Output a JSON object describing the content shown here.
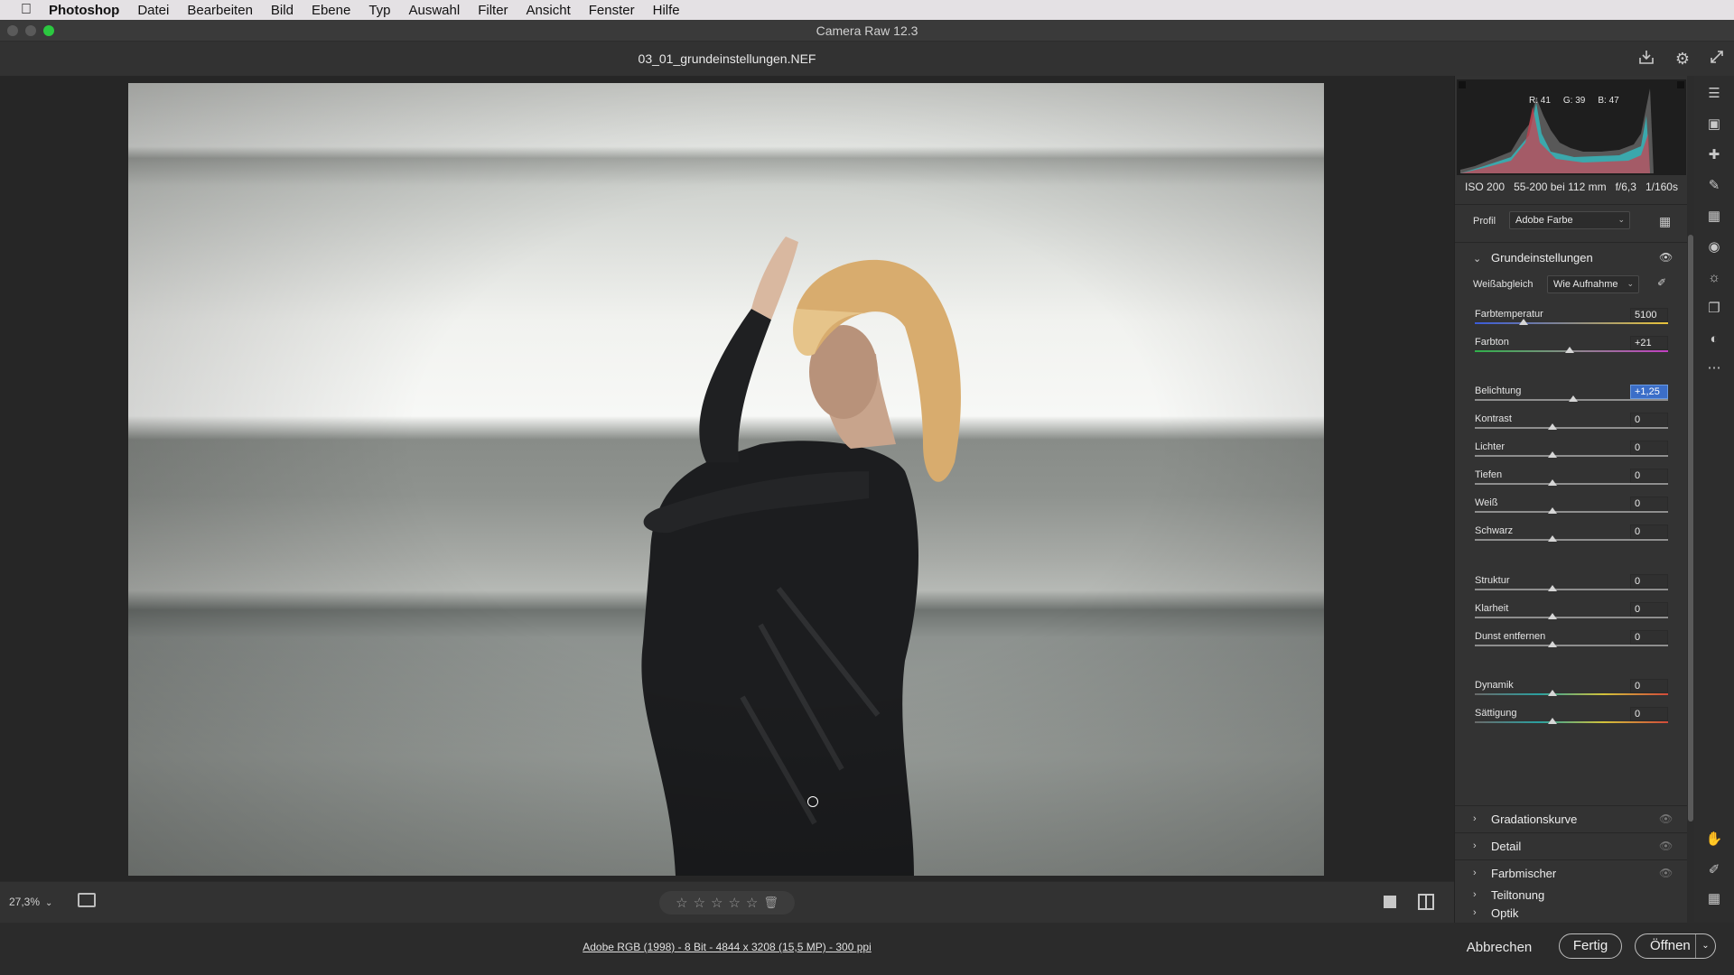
{
  "menubar": {
    "apple": "",
    "items": [
      "Photoshop",
      "Datei",
      "Bearbeiten",
      "Bild",
      "Ebene",
      "Typ",
      "Auswahl",
      "Filter",
      "Ansicht",
      "Fenster",
      "Hilfe"
    ]
  },
  "window": {
    "title": "Camera Raw 12.3"
  },
  "header": {
    "filename": "03_01_grundeinstellungen.NEF",
    "icons": [
      "save-icon",
      "gear-icon",
      "fullscreen-icon"
    ]
  },
  "histogram": {
    "r": "R: 41",
    "g": "G: 39",
    "b": "B: 47"
  },
  "exif": {
    "iso": "ISO 200",
    "lens": "55-200 bei 112 mm",
    "aperture": "f/6,3",
    "shutter": "1/160s"
  },
  "profile": {
    "label": "Profil",
    "value": "Adobe Farbe"
  },
  "basic": {
    "title": "Grundeinstellungen",
    "wb_label": "Weißabgleich",
    "wb_value": "Wie Aufnahme",
    "sliders": [
      {
        "label": "Farbtemperatur",
        "value": "5100",
        "pos": 0.25,
        "active": false
      },
      {
        "label": "Farbton",
        "value": "+21",
        "pos": 0.49,
        "active": false
      },
      {
        "label": "Belichtung",
        "value": "+1,25",
        "pos": 0.51,
        "active": true
      },
      {
        "label": "Kontrast",
        "value": "0",
        "pos": 0.4,
        "active": false
      },
      {
        "label": "Lichter",
        "value": "0",
        "pos": 0.4,
        "active": false
      },
      {
        "label": "Tiefen",
        "value": "0",
        "pos": 0.4,
        "active": false
      },
      {
        "label": "Weiß",
        "value": "0",
        "pos": 0.4,
        "active": false
      },
      {
        "label": "Schwarz",
        "value": "0",
        "pos": 0.4,
        "active": false
      },
      {
        "label": "Struktur",
        "value": "0",
        "pos": 0.4,
        "active": false
      },
      {
        "label": "Klarheit",
        "value": "0",
        "pos": 0.4,
        "active": false
      },
      {
        "label": "Dunst entfernen",
        "value": "0",
        "pos": 0.4,
        "active": false
      },
      {
        "label": "Dynamik",
        "value": "0",
        "pos": 0.4,
        "active": false
      },
      {
        "label": "Sättigung",
        "value": "0",
        "pos": 0.4,
        "active": false
      }
    ]
  },
  "sections": [
    "Gradationskurve",
    "Detail",
    "Farbmischer",
    "Teiltonung",
    "Optik"
  ],
  "toolbar_bottom": {
    "zoom": "27,3%",
    "rating_stars": 0,
    "stars_total": 5
  },
  "footer": {
    "info": "Adobe RGB (1998) - 8 Bit - 4844 x 3208 (15,5 MP) - 300 ppi",
    "cancel": "Abbrechen",
    "done": "Fertig",
    "open": "Öffnen"
  },
  "tools": [
    "edit-icon",
    "crop-icon",
    "healing-icon",
    "brush-icon",
    "gradient-icon",
    "radial-icon",
    "redeye-icon",
    "snapshots-icon",
    "presets-icon",
    "more-icon",
    "hand-icon",
    "eyedropper-icon",
    "grid-icon"
  ],
  "colors": {
    "accent": "#3b6ec8",
    "window_green": "#2bc840"
  }
}
